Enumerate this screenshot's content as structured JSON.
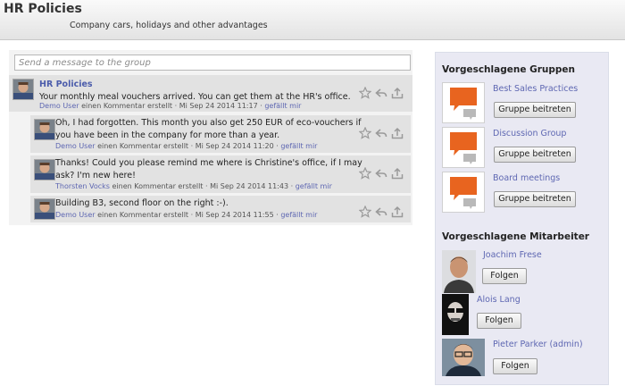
{
  "header": {
    "title": "HR Policies",
    "subtitle": "Company cars, holidays and other advantages"
  },
  "composer": {
    "placeholder": "Send a message to the group"
  },
  "messages": [
    {
      "author": "HR Policies",
      "text": "Your monthly meal vouchers arrived. You can get them at the HR's office.",
      "commenter": "Demo User",
      "action": "einen Kommentar erstellt",
      "timestamp": "Mi Sep 24 2014 11:17",
      "like": "gefällt mir"
    },
    {
      "text_line1": "Oh, I had forgotten. This month you also get 250 EUR of eco-vouchers if",
      "text_line2": "you have been in the company for more than a year.",
      "commenter": "Demo User",
      "action": "einen Kommentar erstellt",
      "timestamp": "Mi Sep 24 2014 11:20",
      "like": "gefällt mir"
    },
    {
      "text_line1": "Thanks! Could you please remind me where is Christine's office, if I may",
      "text_line2": "ask? I'm new here!",
      "commenter": "Thorsten Vocks",
      "action": "einen Kommentar erstellt",
      "timestamp": "Mi Sep 24 2014 11:43",
      "like": "gefällt mir"
    },
    {
      "text": "Building B3, second floor on the right :-).",
      "commenter": "Demo User",
      "action": "einen Kommentar erstellt",
      "timestamp": "Mi Sep 24 2014 11:55",
      "like": "gefällt mir"
    }
  ],
  "sidebar": {
    "groups_title": "Vorgeschlagene Gruppen",
    "groups": [
      {
        "name": "Best Sales Practices",
        "button": "Gruppe beitreten"
      },
      {
        "name": "Discussion Group",
        "button": "Gruppe beitreten"
      },
      {
        "name": "Board meetings",
        "button": "Gruppe beitreten"
      }
    ],
    "people_title": "Vorgeschlagene Mitarbeiter",
    "people": [
      {
        "name": "Joachim Frese",
        "button": "Folgen"
      },
      {
        "name": "Alois Lang",
        "button": "Folgen"
      },
      {
        "name": "Pieter Parker (admin)",
        "button": "Folgen"
      }
    ]
  },
  "icons": {
    "star": "star-icon",
    "reply": "reply-icon",
    "share": "share-icon",
    "group": "chat-bubbles-icon"
  },
  "colors": {
    "link": "#5e67b2",
    "author": "#4b5cab",
    "bubble_orange": "#e8641f",
    "bubble_grey": "#b9b9b9",
    "sidebar_bg": "#e9e9f3"
  }
}
